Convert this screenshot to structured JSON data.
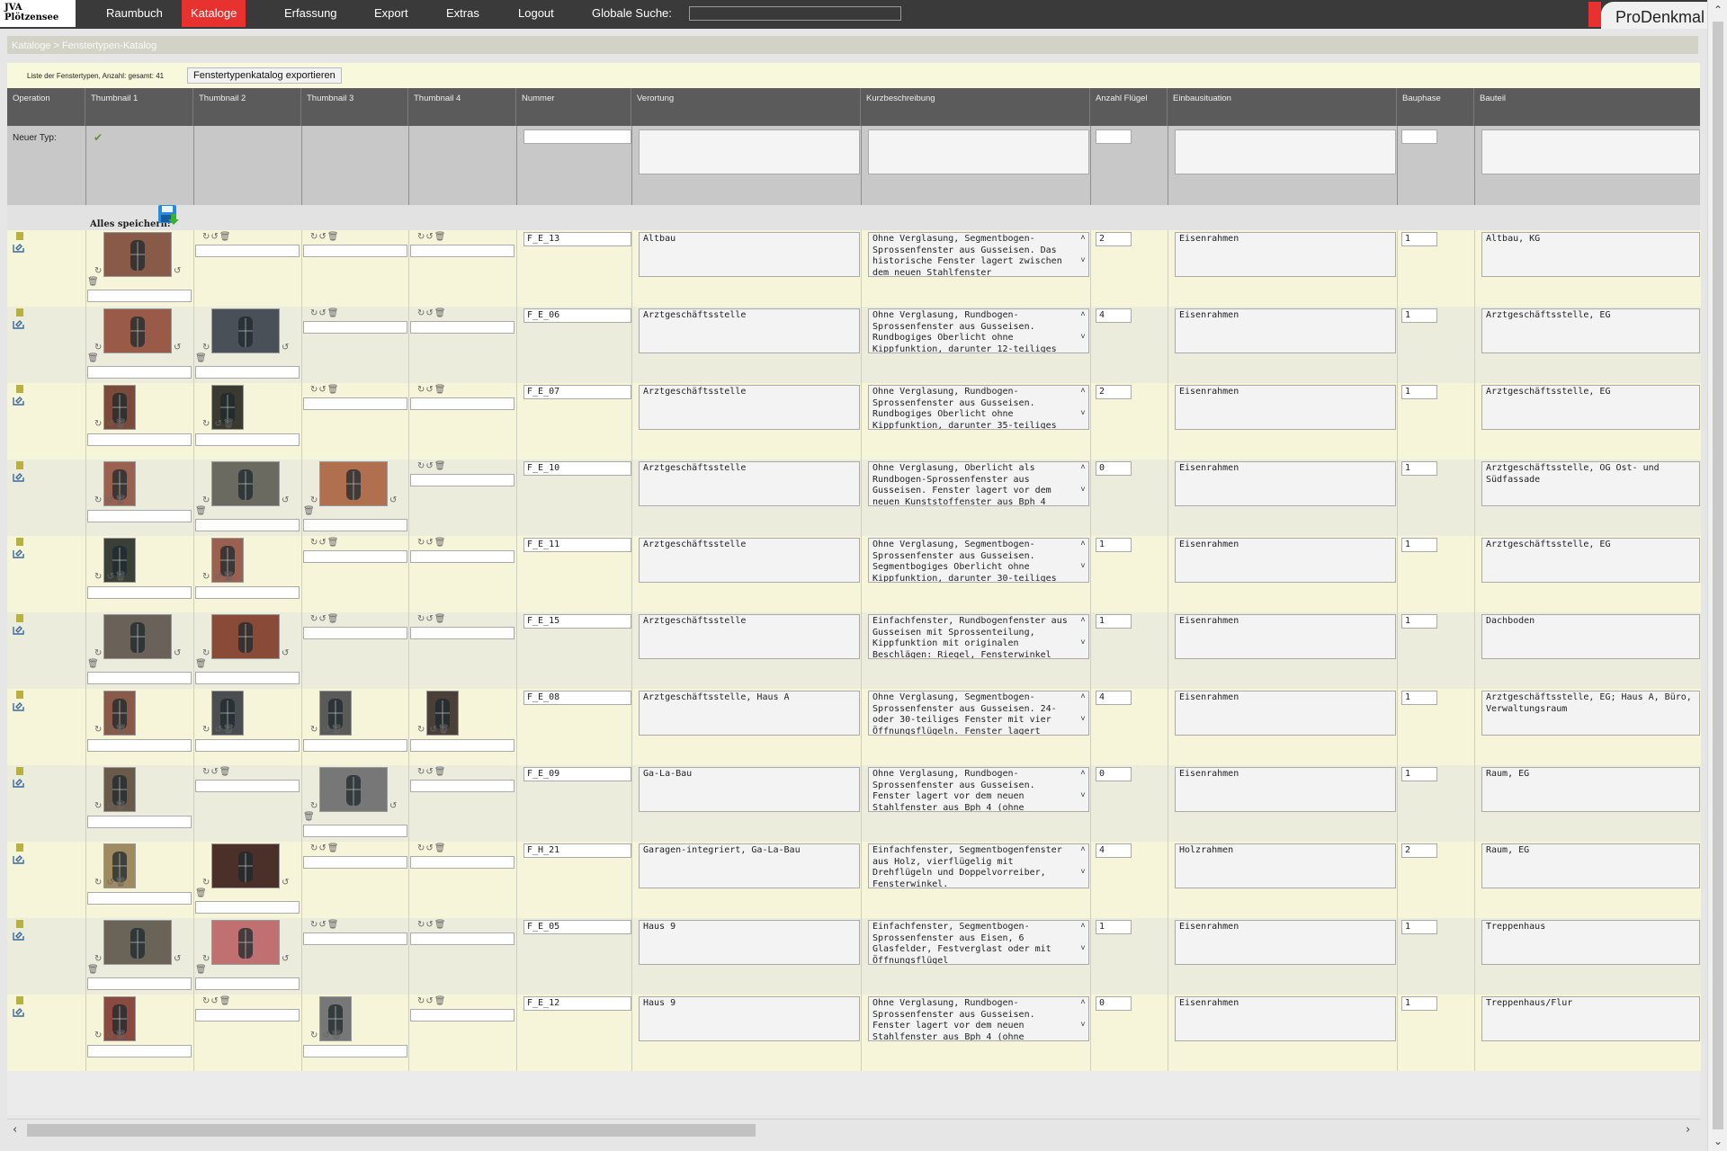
{
  "app": {
    "logo_line1": "JVA",
    "logo_line2": "Plötzensee",
    "brand": "ProDenkmal"
  },
  "nav": {
    "items": [
      {
        "label": "Raumbuch",
        "active": false
      },
      {
        "label": "Kataloge",
        "active": true
      },
      {
        "label": "Erfassung",
        "active": false
      },
      {
        "label": "Export",
        "active": false
      },
      {
        "label": "Extras",
        "active": false
      },
      {
        "label": "Logout",
        "active": false
      }
    ],
    "search_label": "Globale Suche:",
    "search_value": ""
  },
  "breadcrumb": "Kataloge > Fenstertypen-Katalog",
  "list_info": "Liste der Fenstertypen, Anzahl: gesamt: 41",
  "export_button": "Fenstertypenkatalog exportieren",
  "columns": {
    "operation": "Operation",
    "thumb1": "Thumbnail 1",
    "thumb2": "Thumbnail 2",
    "thumb3": "Thumbnail 3",
    "thumb4": "Thumbnail 4",
    "nummer": "Nummer",
    "verortung": "Verortung",
    "kurz": "Kurzbeschreibung",
    "fluegel": "Anzahl Flügel",
    "einbau": "Einbausituation",
    "bauphase": "Bauphase",
    "bauteil": "Bauteil"
  },
  "new_row_label": "Neuer Typ:",
  "save_all_label": "Alles speichern:",
  "colors": {
    "accent": "#e8322f",
    "topbar": "#3a3a3a",
    "header": "#5b5b5b",
    "row_cream": "#f7f5d9",
    "row_light": "#ececdd"
  },
  "rows": [
    {
      "nummer": "F_E_13",
      "verortung": "Altbau",
      "kurz": "Ohne Verglasung, Segmentbogen-Sprossenfenster aus Gusseisen. Das historische Fenster lagert zwischen dem neuen Stahlfenster",
      "fluegel": "2",
      "einbau": "Eisenrahmen",
      "bauphase": "1",
      "bauteil": "Altbau, KG",
      "thumbs": [
        1,
        0,
        0,
        0
      ],
      "thumb_colors": [
        "#8a5a48"
      ]
    },
    {
      "nummer": "F_E_06",
      "verortung": "Arztgeschäftsstelle",
      "kurz": "Ohne Verglasung, Rundbogen-Sprossenfenster aus Gusseisen. Rundbogiges Oberlicht ohne Kippfunktion, darunter 12-teiliges",
      "fluegel": "4",
      "einbau": "Eisenrahmen",
      "bauphase": "1",
      "bauteil": "Arztgeschäftsstelle, EG",
      "thumbs": [
        1,
        1,
        0,
        0
      ],
      "thumb_colors": [
        "#9a5a48",
        "#4a5058"
      ]
    },
    {
      "nummer": "F_E_07",
      "verortung": "Arztgeschäftsstelle",
      "kurz": "Ohne Verglasung, Rundbogen-Sprossenfenster aus Gusseisen. Rundbogiges Oberlicht ohne Kippfunktion, darunter 35-teiliges",
      "fluegel": "2",
      "einbau": "Eisenrahmen",
      "bauphase": "1",
      "bauteil": "Arztgeschäftsstelle, EG",
      "thumbs": [
        2,
        2,
        0,
        0
      ],
      "thumb_colors": [
        "#7a4a3a",
        "#3a3a30"
      ]
    },
    {
      "nummer": "F_E_10",
      "verortung": "Arztgeschäftsstelle",
      "kurz": "Ohne Verglasung, Oberlicht als Rundbogen-Sprossenfenster aus Gusseisen. Fenster lagert vor dem neuen Kunststoffenster aus Bph 4",
      "fluegel": "0",
      "einbau": "Eisenrahmen",
      "bauphase": "1",
      "bauteil": "Arztgeschäftsstelle, OG Ost- und Südfassade",
      "thumbs": [
        2,
        1,
        1,
        0
      ],
      "thumb_colors": [
        "#9a6050",
        "#6a6a60",
        "#b07050"
      ]
    },
    {
      "nummer": "F_E_11",
      "verortung": "Arztgeschäftsstelle",
      "kurz": "Ohne Verglasung, Segmentbogen-Sprossenfenster aus Gusseisen. Segmentbogiges Oberlicht ohne Kippfunktion, darunter 30-teiliges",
      "fluegel": "1",
      "einbau": "Eisenrahmen",
      "bauphase": "1",
      "bauteil": "Arztgeschäftsstelle, EG",
      "thumbs": [
        2,
        2,
        0,
        0
      ],
      "thumb_colors": [
        "#3a4038",
        "#9a6050"
      ]
    },
    {
      "nummer": "F_E_15",
      "verortung": "Arztgeschäftsstelle",
      "kurz": "Einfachfenster, Rundbogenfenster aus Gusseisen mit Sprossenteilung, Kippfunktion mit originalen Beschlägen: Riegel, Fensterwinkel",
      "fluegel": "1",
      "einbau": "Eisenrahmen",
      "bauphase": "1",
      "bauteil": "Dachboden",
      "thumbs": [
        1,
        1,
        0,
        0
      ],
      "thumb_colors": [
        "#6a6258",
        "#8a4a38"
      ]
    },
    {
      "nummer": "F_E_08",
      "verortung": "Arztgeschäftsstelle, Haus A",
      "kurz": "Ohne Verglasung, Segmentbogen-Sprossenfenster aus Gusseisen. 24- oder 30-teiliges Fenster mit vier Öffnungsflügeln. Fenster lagert",
      "fluegel": "4",
      "einbau": "Eisenrahmen",
      "bauphase": "1",
      "bauteil": "Arztgeschäftsstelle, EG; Haus A, Büro, Verwaltungsraum",
      "thumbs": [
        2,
        2,
        2,
        2
      ],
      "thumb_colors": [
        "#8a5a48",
        "#4a4e50",
        "#5a5a58",
        "#4a4038"
      ]
    },
    {
      "nummer": "F_E_09",
      "verortung": "Ga-La-Bau",
      "kurz": "Ohne Verglasung, Rundbogen-Sprossenfenster aus Gusseisen. Fenster lagert vor dem neuen Stahlfenster aus Bph 4 (ohne",
      "fluegel": "0",
      "einbau": "Eisenrahmen",
      "bauphase": "1",
      "bauteil": "Raum, EG",
      "thumbs": [
        2,
        0,
        1,
        0
      ],
      "thumb_colors": [
        "#6a5a4a",
        "#7a7060"
      ]
    },
    {
      "nummer": "F_H_21",
      "verortung": "Garagen-integriert, Ga-La-Bau",
      "kurz": "Einfachfenster, Segmentbogenfenster aus Holz, vierflügelig mit Drehflügeln und Doppelvorreiber, Fensterwinkel.",
      "fluegel": "4",
      "einbau": "Holzrahmen",
      "bauphase": "2",
      "bauteil": "Raum, EG",
      "thumbs": [
        2,
        1,
        0,
        0
      ],
      "thumb_colors": [
        "#a08a60",
        "#4a3028"
      ]
    },
    {
      "nummer": "F_E_05",
      "verortung": "Haus 9",
      "kurz": "Einfachfenster, Segmentbogen-Sprossenfenster aus Eisen, 6 Glasfelder, Festverglast oder mit Öffnungsflügel",
      "fluegel": "1",
      "einbau": "Eisenrahmen",
      "bauphase": "1",
      "bauteil": "Treppenhaus",
      "thumbs": [
        1,
        1,
        0,
        0
      ],
      "thumb_colors": [
        "#6a6458",
        "#c07070"
      ]
    },
    {
      "nummer": "F_E_12",
      "verortung": "Haus 9",
      "kurz": "Ohne Verglasung, Rundbogen-Sprossenfenster aus Gusseisen. Fenster lagert vor dem neuen Stahlfenster aus Bph 4 (ohne",
      "fluegel": "0",
      "einbau": "Eisenrahmen",
      "bauphase": "1",
      "bauteil": "Treppenhaus/Flur",
      "thumbs": [
        2,
        0,
        2,
        0
      ],
      "thumb_colors": [
        "#8a4a40",
        "#2a3028"
      ]
    }
  ]
}
